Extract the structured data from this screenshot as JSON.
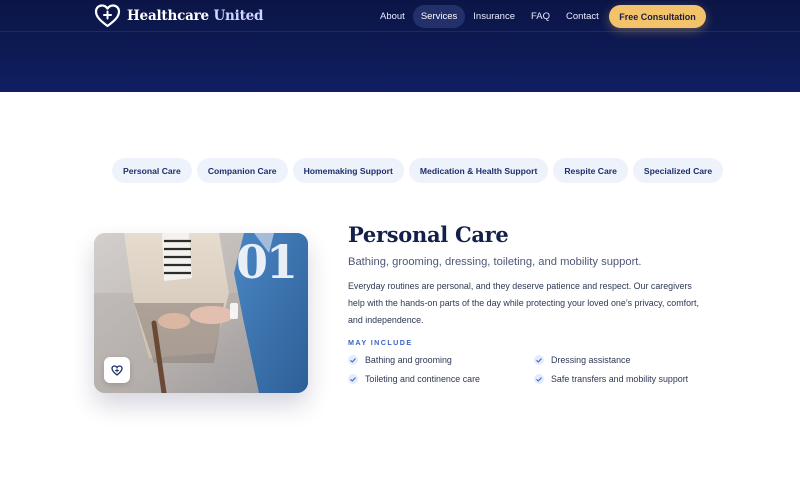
{
  "brand": {
    "name_part1": "Healthcare",
    "name_part2": "United"
  },
  "nav": {
    "items": [
      {
        "label": "About"
      },
      {
        "label": "Services",
        "active": true
      },
      {
        "label": "Insurance"
      },
      {
        "label": "FAQ"
      },
      {
        "label": "Contact"
      }
    ],
    "cta_label": "Free Consultation"
  },
  "tabs": [
    {
      "label": "Personal Care"
    },
    {
      "label": "Companion Care"
    },
    {
      "label": "Homemaking Support"
    },
    {
      "label": "Medication & Health Support"
    },
    {
      "label": "Respite Care"
    },
    {
      "label": "Specialized Care"
    }
  ],
  "service": {
    "number": "01",
    "title": "Personal Care",
    "subtitle": "Bathing, grooming, dressing, toileting, and mobility support.",
    "description": "Everyday routines are personal, and they deserve patience and respect. Our caregivers help with the hands-on parts of the day while protecting your loved one’s privacy, comfort, and independence.",
    "may_include_label": "MAY INCLUDE",
    "features": [
      "Bathing and grooming",
      "Dressing assistance",
      "Toileting and continence care",
      "Safe transfers and mobility support"
    ]
  },
  "colors": {
    "header_bg": "#0c1546",
    "accent_gold": "#f2c36b",
    "tab_bg": "#eef3fb",
    "title_navy": "#14204a",
    "accent_blue": "#3c63c4"
  },
  "icons": {
    "logo": "heart-plus-icon",
    "badge": "heart-icon",
    "check": "check-icon"
  }
}
